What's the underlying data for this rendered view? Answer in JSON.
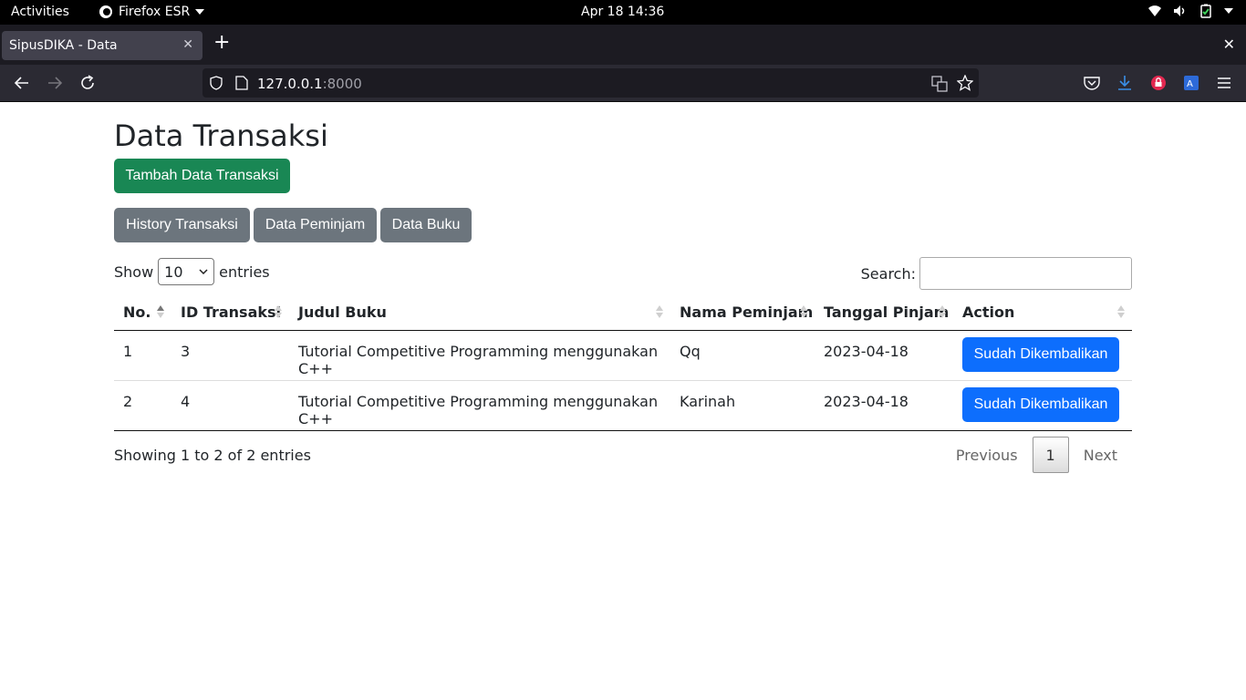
{
  "system": {
    "activities": "Activities",
    "app_name": "Firefox ESR",
    "clock": "Apr 18  14:36"
  },
  "browser": {
    "tab_title": "SipusDIKA - Data",
    "url_host": "127.0.0.1",
    "url_port": ":8000"
  },
  "page": {
    "title": "Data Transaksi",
    "add_button": "Tambah Data Transaksi",
    "nav_buttons": [
      "History Transaksi",
      "Data Peminjam",
      "Data Buku"
    ]
  },
  "table_controls": {
    "show_label": "Show",
    "entries_value": "10",
    "entries_label": "entries",
    "search_label": "Search:"
  },
  "table": {
    "columns": [
      "No.",
      "ID Transaksi",
      "Judul Buku",
      "Nama Peminjam",
      "Tanggal Pinjam",
      "Action"
    ],
    "rows": [
      {
        "no": "1",
        "id": "3",
        "judul": "Tutorial Competitive Programming menggunakan C++",
        "nama": "Qq",
        "tanggal": "2023-04-18",
        "action": "Sudah Dikembalikan"
      },
      {
        "no": "2",
        "id": "4",
        "judul": "Tutorial Competitive Programming menggunakan C++",
        "nama": "Karinah",
        "tanggal": "2023-04-18",
        "action": "Sudah Dikembalikan"
      }
    ]
  },
  "footer": {
    "info": "Showing 1 to 2 of 2 entries",
    "previous": "Previous",
    "current_page": "1",
    "next": "Next"
  },
  "colors": {
    "success": "#198754",
    "secondary": "#6c757d",
    "primary": "#0d6efd"
  }
}
